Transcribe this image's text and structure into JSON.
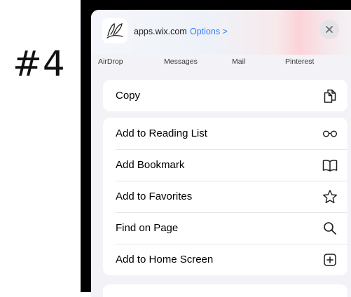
{
  "annotation": {
    "step": "#4"
  },
  "sheet": {
    "site_url": "apps.wix.com",
    "options_label": "Options >",
    "share_targets": [
      "AirDrop",
      "Messages",
      "Mail",
      "Pinterest"
    ],
    "actions": [
      {
        "label": "Copy",
        "icon": "copy-icon"
      },
      {
        "label": "Add to Reading List",
        "icon": "glasses-icon"
      },
      {
        "label": "Add Bookmark",
        "icon": "book-icon"
      },
      {
        "label": "Add to Favorites",
        "icon": "star-icon"
      },
      {
        "label": "Find on Page",
        "icon": "magnifier-icon"
      },
      {
        "label": "Add to Home Screen",
        "icon": "plus-square-icon"
      }
    ]
  },
  "colors": {
    "accent": "#2f7cf6",
    "background": "#f2f2f7",
    "frame": "#000000"
  }
}
